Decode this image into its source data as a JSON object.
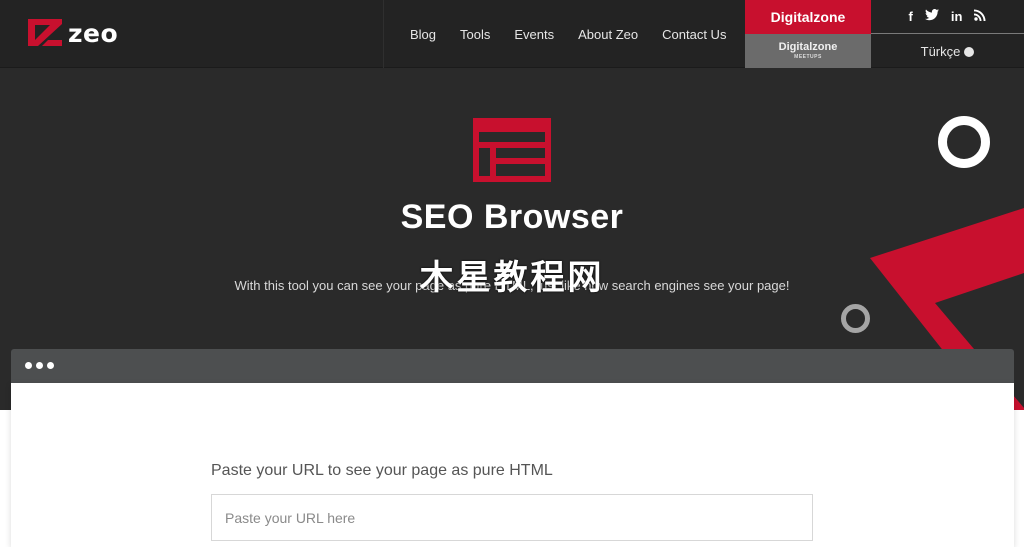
{
  "header": {
    "logo_text": "zeo",
    "nav": [
      "Blog",
      "Tools",
      "Events",
      "About Zeo",
      "Contact Us"
    ],
    "digitalzone": "Digitalzone",
    "digitalzone_meetups": "Digitalzone",
    "digitalzone_meetups_sub": "MEETUPS",
    "social": {
      "facebook": "f",
      "twitter": "t",
      "linkedin": "in",
      "rss": "rss"
    },
    "language": "Türkçe"
  },
  "hero": {
    "title": "SEO Browser",
    "subtitle": "With this tool you can see your page as pure HTML, just like how search engines see your page!",
    "watermark": "木星教程网"
  },
  "form": {
    "label": "Paste your URL to see your page as pure HTML",
    "placeholder": "Paste your URL here"
  },
  "colors": {
    "accent": "#c8102e",
    "dark": "#2a2a2a",
    "header": "#232323"
  }
}
